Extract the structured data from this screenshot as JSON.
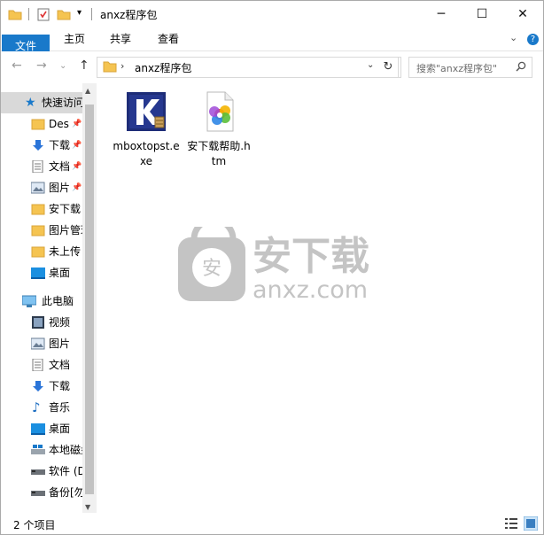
{
  "window": {
    "title": "anxz程序包"
  },
  "ribbon": {
    "tabs": [
      {
        "label": "文件"
      },
      {
        "label": "主页"
      },
      {
        "label": "共享"
      },
      {
        "label": "查看"
      }
    ]
  },
  "address": {
    "path": "anxz程序包",
    "search_placeholder": "搜索\"anxz程序包\""
  },
  "nav": {
    "quick_access": "快速访问",
    "quick_items": [
      {
        "label": "Des",
        "icon": "folder-desktop-icon",
        "pinned": true
      },
      {
        "label": "下载",
        "icon": "download-icon",
        "pinned": true
      },
      {
        "label": "文档",
        "icon": "document-icon",
        "pinned": true
      },
      {
        "label": "图片",
        "icon": "picture-icon",
        "pinned": true
      },
      {
        "label": "安下载",
        "icon": "folder-icon",
        "pinned": false
      },
      {
        "label": "图片管理",
        "icon": "folder-icon",
        "pinned": false
      },
      {
        "label": "未上传",
        "icon": "folder-icon",
        "pinned": false
      },
      {
        "label": "桌面",
        "icon": "desktop-icon",
        "pinned": false
      }
    ],
    "this_pc": "此电脑",
    "pc_items": [
      {
        "label": "视频",
        "icon": "video-icon"
      },
      {
        "label": "图片",
        "icon": "picture-icon"
      },
      {
        "label": "文档",
        "icon": "document-icon"
      },
      {
        "label": "下载",
        "icon": "download-icon"
      },
      {
        "label": "音乐",
        "icon": "music-icon"
      },
      {
        "label": "桌面",
        "icon": "desktop-icon"
      },
      {
        "label": "本地磁盘",
        "icon": "local-disk-icon"
      },
      {
        "label": "软件 (D",
        "icon": "drive-icon"
      },
      {
        "label": "备份[勿",
        "icon": "drive-icon"
      }
    ]
  },
  "files": [
    {
      "name": "mboxtopst.exe",
      "icon": "kernel-app-icon"
    },
    {
      "name": "安下载帮助.htm",
      "icon": "htm-file-icon"
    }
  ],
  "watermark": {
    "cn": "安下载",
    "en": "anxz.com",
    "badge": "安"
  },
  "status": {
    "count": "2 个项目"
  },
  "colors": {
    "accent": "#1979ca",
    "folder": "#f5c451",
    "selection": "#d9d9d9"
  }
}
